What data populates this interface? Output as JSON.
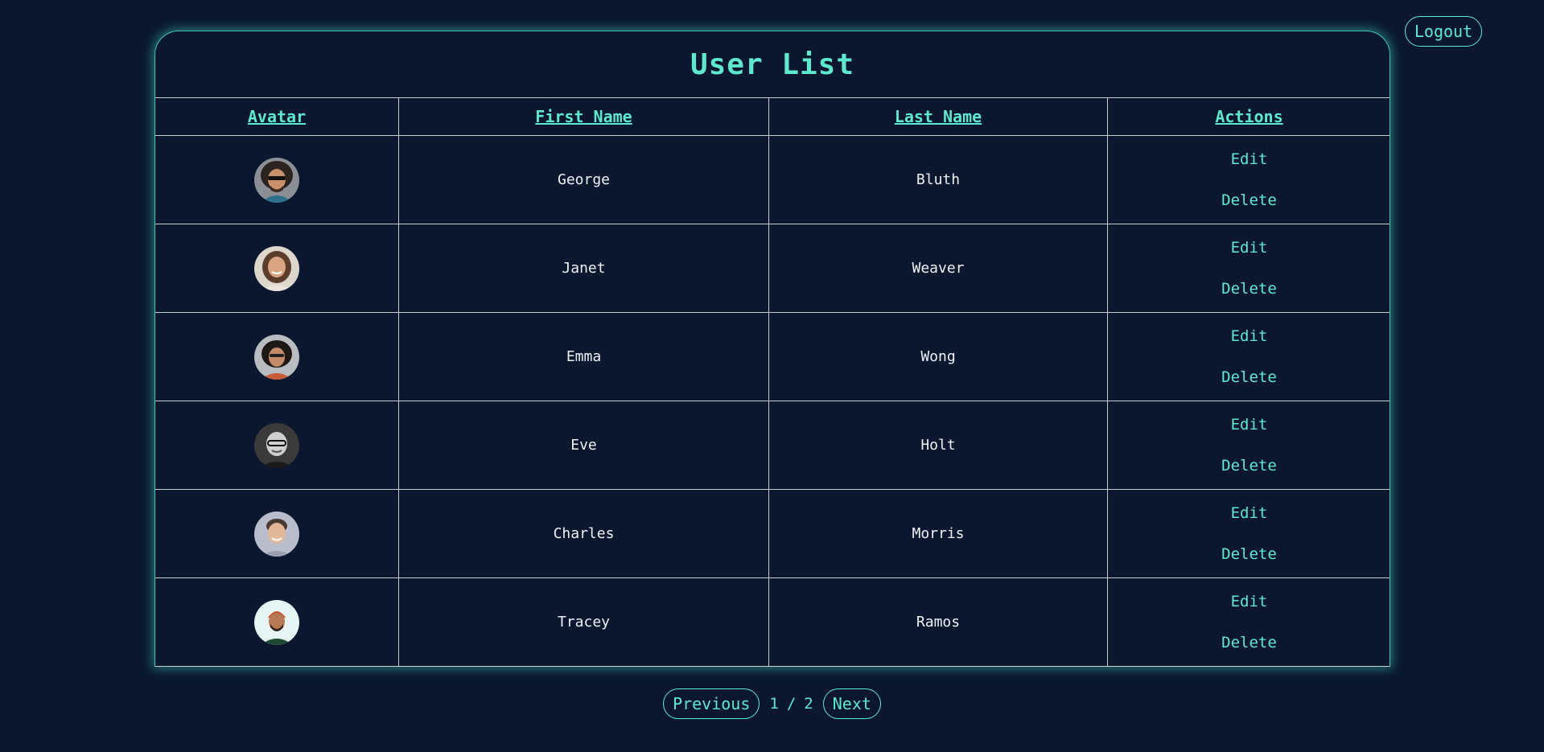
{
  "header": {
    "logout_label": "Logout"
  },
  "card": {
    "title": "User List"
  },
  "table": {
    "columns": [
      "Avatar",
      "First Name",
      "Last Name",
      "Actions"
    ],
    "edit_label": "Edit",
    "delete_label": "Delete",
    "rows": [
      {
        "first_name": "George",
        "last_name": "Bluth"
      },
      {
        "first_name": "Janet",
        "last_name": "Weaver"
      },
      {
        "first_name": "Emma",
        "last_name": "Wong"
      },
      {
        "first_name": "Eve",
        "last_name": "Holt"
      },
      {
        "first_name": "Charles",
        "last_name": "Morris"
      },
      {
        "first_name": "Tracey",
        "last_name": "Ramos"
      }
    ]
  },
  "pagination": {
    "previous_label": "Previous",
    "current_page": "1",
    "separator": "/",
    "total_pages": "2",
    "next_label": "Next"
  },
  "colors": {
    "background": "#0a172f",
    "accent": "#5ee8d0",
    "text": "#eef2f6",
    "border": "#c8ccd2"
  }
}
